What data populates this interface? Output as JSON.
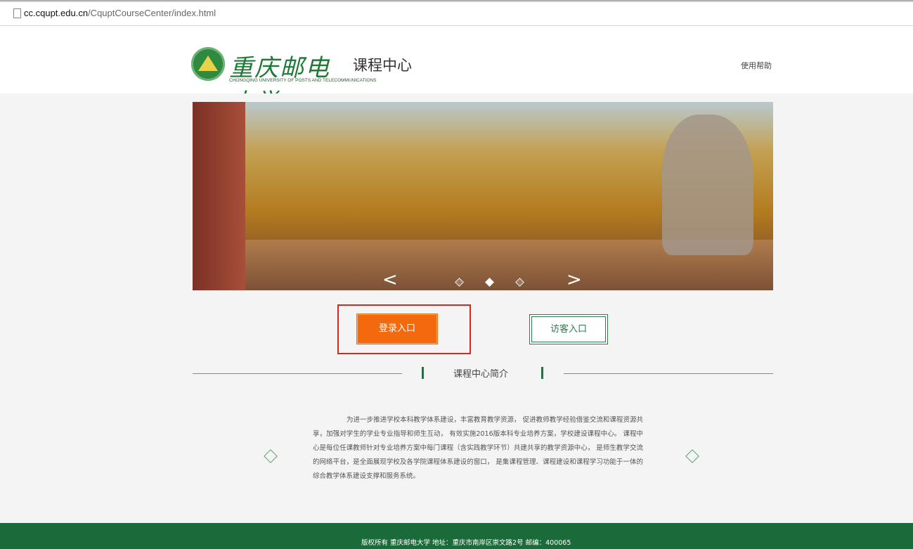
{
  "browser": {
    "url_domain": "cc.cqupt.edu.cn",
    "url_path": "/CquptCourseCenter/index.html"
  },
  "header": {
    "logo_script": "重庆邮电大学",
    "logo_english": "CHONGQING UNIVERSITY OF POSTS AND TELECOMMUNICATIONS",
    "site_name": "课程中心",
    "help_link": "使用帮助"
  },
  "banner": {
    "prev_icon": "chevron-left",
    "next_icon": "chevron-right",
    "prev_glyph": "<",
    "next_glyph": ">",
    "slide_count": 3,
    "active_slide": 2
  },
  "entries": {
    "login": "登录入口",
    "guest": "访客入口"
  },
  "intro": {
    "title": "课程中心简介",
    "body": "为进一步推进学校本科教学体系建设，丰富教育教学资源， 促进教师教学经验借鉴交流和课程资源共享，加强对学生的学业专业指导和师生互动， 有效实施2016版本科专业培养方案，学校建设课程中心。 课程中心是每位任课教师针对专业培养方案中每门课程（含实践教学环节）共建共享的教学资源中心， 是师生教学交流的网络平台，是全面展现学校及各学院课程体系建设的窗口， 是集课程管理、课程建设和课程学习功能于一体的综合教学体系建设支撑和服务系统。"
  },
  "footer": {
    "text": "版权所有 重庆邮电大学 地址：重庆市南岸区崇文路2号 邮编：400065"
  },
  "colors": {
    "brand_green": "#1b6b3a",
    "login_orange": "#f26a0d",
    "highlight_red": "#e2231a"
  }
}
